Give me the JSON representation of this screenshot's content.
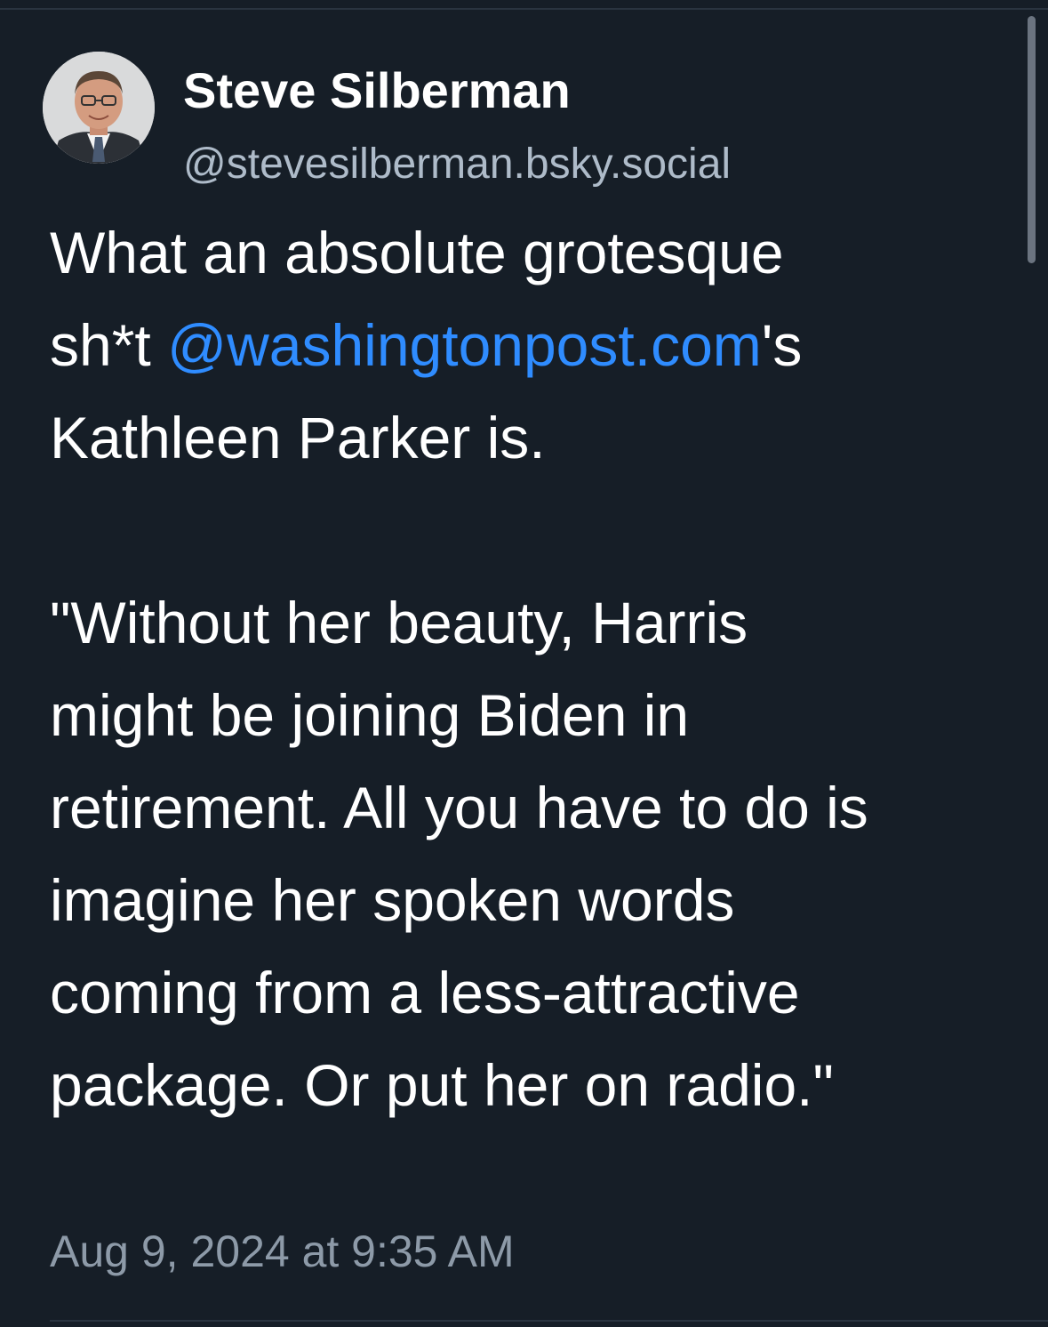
{
  "author": {
    "display_name": "Steve Silberman",
    "handle": "@stevesilberman.bsky.social"
  },
  "post": {
    "line1": "What an absolute grotesque",
    "line2_prefix": "sh*t ",
    "mention": "@washingtonpost.com",
    "line2_suffix": "'s",
    "line3": "Kathleen Parker is.",
    "quote_lines": [
      "\"Without her beauty, Harris",
      "might be joining Biden in",
      "retirement. All you have to do is",
      "imagine her spoken words",
      "coming from a less-attractive",
      "package. Or put her on radio.\""
    ]
  },
  "timestamp": "Aug 9, 2024 at 9:35 AM",
  "colors": {
    "background": "#161e27",
    "mention": "#2f8cff",
    "handle": "#aebbc9",
    "timestamp": "#8d9aa8"
  }
}
